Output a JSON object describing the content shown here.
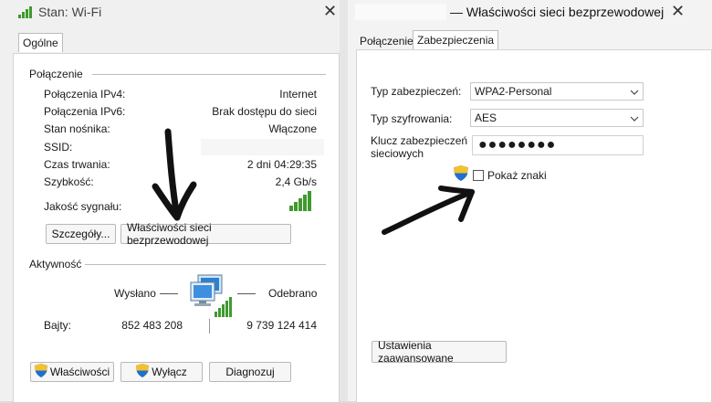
{
  "left_window": {
    "title": "Stan: Wi-Fi",
    "tab": "Ogólne",
    "connection": {
      "heading": "Połączenie",
      "rows": [
        {
          "label": "Połączenia IPv4:",
          "value": "Internet"
        },
        {
          "label": "Połączenia IPv6:",
          "value": "Brak dostępu do sieci"
        },
        {
          "label": "Stan nośnika:",
          "value": "Włączone"
        },
        {
          "label": "SSID:",
          "value": ""
        },
        {
          "label": "Czas trwania:",
          "value": "2 dni 04:29:35"
        },
        {
          "label": "Szybkość:",
          "value": "2,4 Gb/s"
        }
      ],
      "signal_label": "Jakość sygnału:"
    },
    "buttons": {
      "details": "Szczegóły...",
      "wireless_properties": "Właściwości sieci bezprzewodowej"
    },
    "activity": {
      "heading": "Aktywność",
      "sent": "Wysłano",
      "received": "Odebrano",
      "bytes_label": "Bajty:",
      "bytes_sent": "852 483 208",
      "bytes_received": "9 739 124 414"
    },
    "bottom_buttons": {
      "properties": "Właściwości",
      "disable": "Wyłącz",
      "diagnose": "Diagnozuj"
    }
  },
  "right_window": {
    "title": "— Właściwości sieci bezprzewodowej",
    "tabs": [
      "Połączenie",
      "Zabezpieczenia"
    ],
    "security_type_label": "Typ zabezpieczeń:",
    "security_type_value": "WPA2-Personal",
    "encryption_label": "Typ szyfrowania:",
    "encryption_value": "AES",
    "key_label_line1": "Klucz zabezpieczeń",
    "key_label_line2": "sieciowych",
    "key_value": "●●●●●●●●",
    "show_chars": "Pokaż znaki",
    "advanced_button": "Ustawienia zaawansowane"
  },
  "icons": {
    "signal": "signal-bars-icon",
    "shield": "uac-shield-icon",
    "network": "network-computer-icon",
    "arrows": "hand-drawn-arrow-icon"
  },
  "colors": {
    "signal_green": "#3f9a2e",
    "window_bg": "#f0f0f0"
  }
}
